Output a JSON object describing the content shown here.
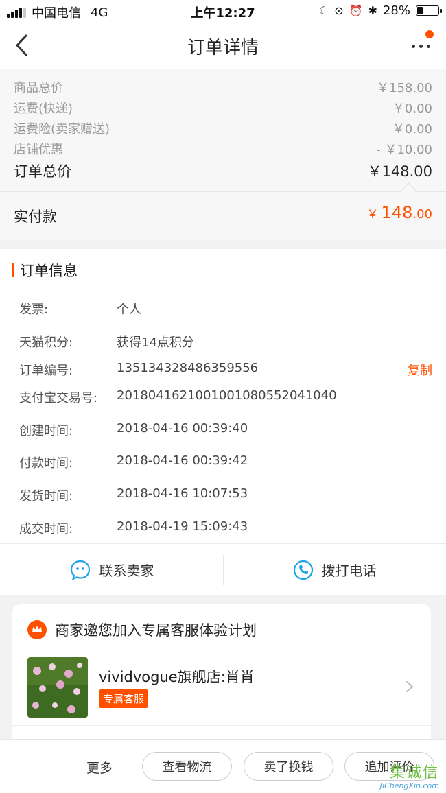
{
  "status_bar": {
    "carrier": "中国电信",
    "network": "4G",
    "time": "上午12:27",
    "battery": "28%",
    "battery_level": 0.28
  },
  "nav": {
    "title": "订单详情"
  },
  "price_summary": {
    "rows": [
      {
        "label": "商品总价",
        "value": "￥158.00"
      },
      {
        "label": "运费(快递)",
        "value": "￥0.00"
      },
      {
        "label": "运费险(卖家赠送)",
        "value": "￥0.00"
      },
      {
        "label": "店铺优惠",
        "value": "- ￥10.00"
      }
    ],
    "total_label": "订单总价",
    "total_value": "￥148.00",
    "paid_label": "实付款",
    "paid_currency": "￥",
    "paid_int": "148",
    "paid_dec": ".00",
    "accent_color": "#ff5000"
  },
  "order_info": {
    "heading": "订单信息",
    "rows": [
      {
        "label": "发票:",
        "value": "个人"
      },
      {
        "label": "天猫积分:",
        "value": "获得14点积分"
      },
      {
        "label": "订单编号:",
        "value": "1351343284863595​56"
      },
      {
        "label": "支付宝交易号:",
        "value": "2018041621001001080552041040"
      },
      {
        "label": "创建时间:",
        "value": "2018-04-16 00:39:40"
      },
      {
        "label": "付款时间:",
        "value": "2018-04-16 00:39:42"
      },
      {
        "label": "发货时间:",
        "value": "2018-04-16 10:07:53"
      },
      {
        "label": "成交时间:",
        "value": "2018-04-19 15:09:43"
      }
    ],
    "copy_label": "复制"
  },
  "contact": {
    "seller_label": "联系卖家",
    "phone_label": "拨打电话"
  },
  "invite_card": {
    "title": "商家邀您加入专属客服体验计划",
    "shop_name": "vividvogue旗舰店:肖肖",
    "tag": "专属客服"
  },
  "bottom_bar": {
    "more": "更多",
    "logistics": "查看物流",
    "sell": "卖了换钱",
    "review": "追加评价"
  },
  "watermark": {
    "chars": [
      "集",
      "诚",
      "信"
    ],
    "domain": "JiChengXin.com"
  }
}
